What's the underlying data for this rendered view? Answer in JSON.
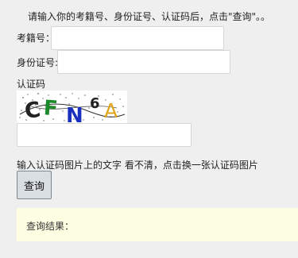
{
  "instruction": "请输入你的考籍号、身份证号、认证码后，点击\"查询\"。。",
  "form": {
    "exam_number_label": "考籍号：",
    "exam_number_value": "",
    "id_number_label": "身份证号:",
    "id_number_value": "",
    "captcha_label": "认证码",
    "captcha_text": "CFN6A",
    "captcha_input_value": ""
  },
  "hint": "输入认证码图片上的文字 看不清，点击换一张认证码图片",
  "query_button_label": "查询",
  "result": {
    "label": "查询结果："
  },
  "colors": {
    "page_bg": "#efefef",
    "result_bg": "#fefee2",
    "captcha_C": "#222222",
    "captcha_F": "#1c8a2a",
    "captcha_N": "#1a2fbf",
    "captcha_6": "#222222",
    "captcha_A": "#e0a51a"
  }
}
